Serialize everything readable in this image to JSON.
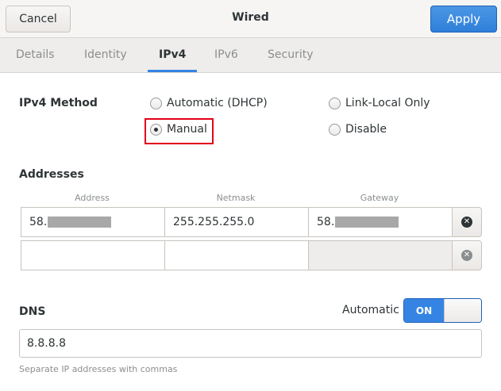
{
  "header": {
    "title": "Wired",
    "cancel_label": "Cancel",
    "apply_label": "Apply"
  },
  "tabs": [
    {
      "label": "Details",
      "active": false
    },
    {
      "label": "Identity",
      "active": false
    },
    {
      "label": "IPv4",
      "active": true
    },
    {
      "label": "IPv6",
      "active": false
    },
    {
      "label": "Security",
      "active": false
    }
  ],
  "ipv4_method": {
    "label": "IPv4 Method",
    "options": [
      {
        "label": "Automatic (DHCP)",
        "checked": false
      },
      {
        "label": "Link-Local Only",
        "checked": false
      },
      {
        "label": "Manual",
        "checked": true
      },
      {
        "label": "Disable",
        "checked": false
      }
    ]
  },
  "addresses": {
    "label": "Addresses",
    "columns": [
      "Address",
      "Netmask",
      "Gateway"
    ],
    "rows": [
      {
        "address": "58.",
        "netmask": "255.255.255.0",
        "gateway": "58."
      },
      {
        "address": "",
        "netmask": "",
        "gateway": ""
      }
    ]
  },
  "dns": {
    "label": "DNS",
    "automatic_label": "Automatic",
    "switch_label": "ON",
    "value": "8.8.8.8",
    "hint": "Separate IP addresses with commas"
  },
  "colors": {
    "accent": "#3584e4",
    "highlight": "#e2001a"
  }
}
